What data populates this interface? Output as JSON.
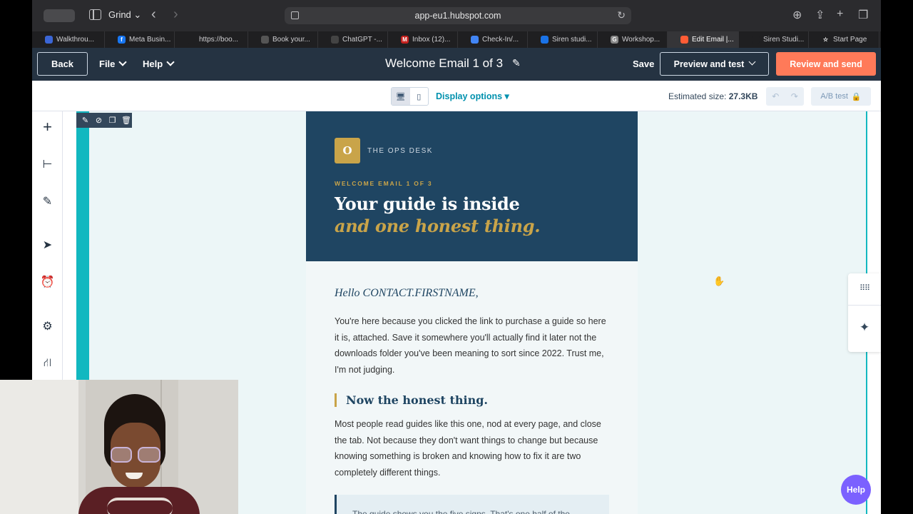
{
  "browser": {
    "profile": "Grind",
    "url": "app-eu1.hubspot.com",
    "tabs": [
      {
        "label": "Walkthrou...",
        "color": "#3b66d6",
        "glyph": "",
        "w": 102
      },
      {
        "label": "Meta Busin...",
        "color": "#1877f2",
        "glyph": "f",
        "w": 98
      },
      {
        "label": "https://boo...",
        "color": "#1f1f21",
        "glyph": "",
        "w": 103
      },
      {
        "label": "Book your...",
        "color": "#555",
        "glyph": "",
        "w": 98
      },
      {
        "label": "ChatGPT -...",
        "color": "#444",
        "glyph": "",
        "w": 98
      },
      {
        "label": "Inbox (12)...",
        "color": "#c5221f",
        "glyph": "M",
        "w": 98
      },
      {
        "label": "Check-In/...",
        "color": "#4285f4",
        "glyph": "",
        "w": 98
      },
      {
        "label": "Siren studi...",
        "color": "#1a73e8",
        "glyph": "",
        "w": 98
      },
      {
        "label": "Workshop...",
        "color": "#888",
        "glyph": "G",
        "w": 98
      },
      {
        "label": "Edit Email |...",
        "color": "#ff5c35",
        "glyph": "",
        "w": 100,
        "active": true
      },
      {
        "label": "Siren Studi...",
        "color": "#1f1f21",
        "glyph": "",
        "w": 98
      },
      {
        "label": "Start Page",
        "color": "#1f1f21",
        "glyph": "☆",
        "w": 99
      }
    ]
  },
  "header": {
    "back": "Back",
    "file": "File",
    "help": "Help",
    "title": "Welcome Email 1 of 3",
    "save": "Save",
    "preview": "Preview and test",
    "review": "Review and send"
  },
  "subbar": {
    "display_options": "Display options ▾",
    "est_label": "Estimated size:",
    "est_value": "27.3KB",
    "ab_test": "A/B test"
  },
  "email": {
    "logo_letter": "O",
    "brand": "THE OPS DESK",
    "eyebrow": "WELCOME EMAIL 1 OF 3",
    "headline_1": "Your guide is inside",
    "headline_2": "and one honest thing.",
    "greeting": "Hello CONTACT.FIRSTNAME,",
    "para_1": "You're here because you clicked the link to purchase a guide so here it is, attached. Save it somewhere you'll actually find it later not the downloads folder you've been meaning to sort since 2022. Trust me, I'm not judging.",
    "subhead": "Now the honest thing.",
    "para_2": "Most people read guides like this one, nod at every page, and close the tab. Not because they don't want things to change but because knowing something is broken and knowing how to fix it are two completely different things.",
    "quote": "The guide shows you the five signs. That's one half of the"
  },
  "help_button": "Help"
}
